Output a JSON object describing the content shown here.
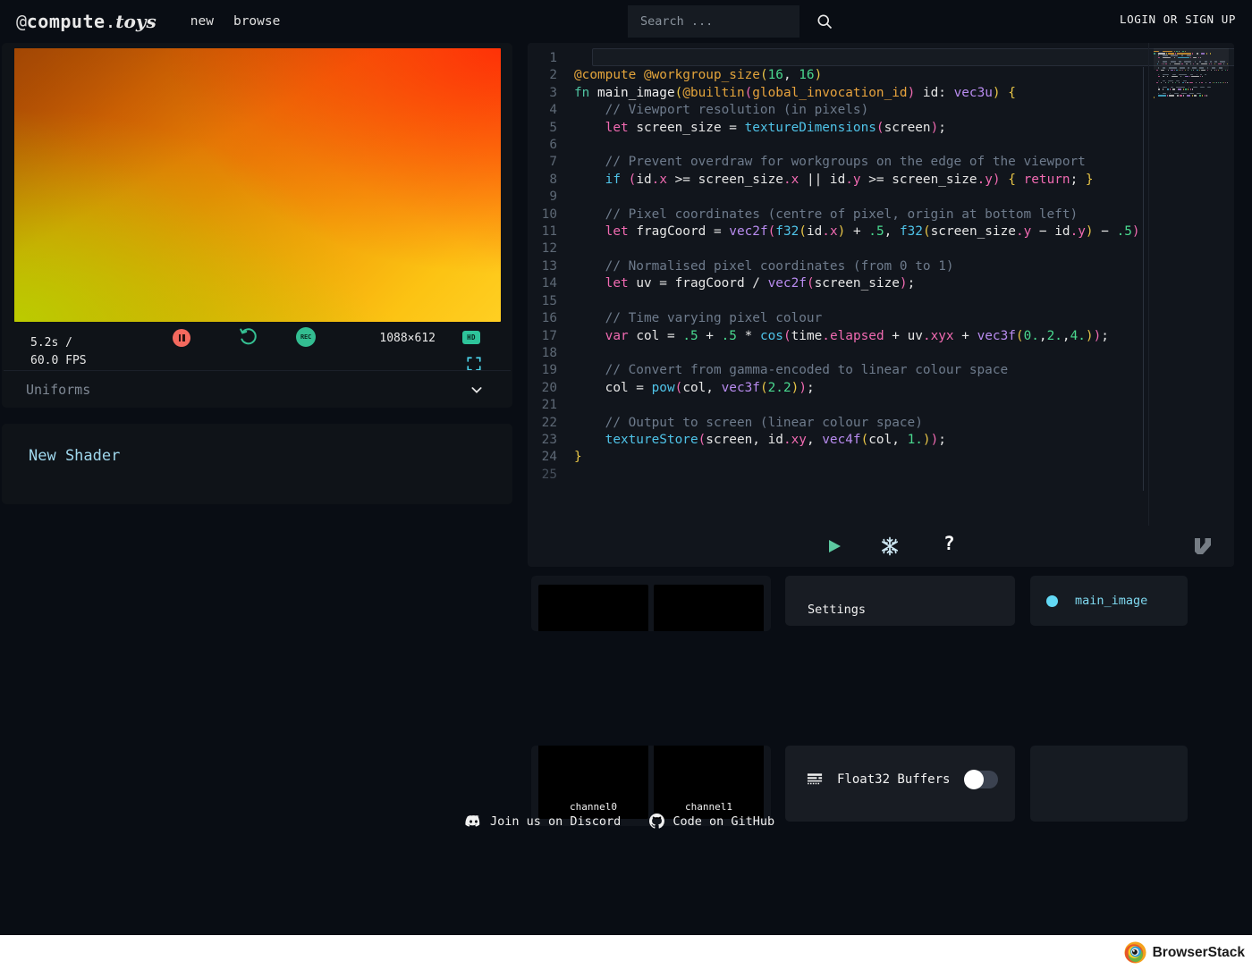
{
  "header": {
    "logo": {
      "at": "@",
      "compute": "compute",
      "dot": ".",
      "toys": "toys"
    },
    "nav": [
      {
        "label": "new",
        "name": "nav-new"
      },
      {
        "label": "browse",
        "name": "nav-browse"
      }
    ],
    "search": {
      "placeholder": "Search ...",
      "value": "",
      "icon": "search-icon"
    },
    "login_label": "LOGIN OR SIGN UP"
  },
  "preview": {
    "time": "5.2s /",
    "fps": "60.0 FPS",
    "resolution": "1088×612",
    "hd_badge": "HD",
    "pause_icon": "pause-icon",
    "reset_icon": "reset-icon",
    "record_icon": "record-icon",
    "record_label": "REC",
    "fullscreen_icon": "fullscreen-icon",
    "uniforms_label": "Uniforms",
    "chevron_icon": "chevron-down-icon"
  },
  "shader": {
    "name": "New Shader"
  },
  "editor": {
    "lines": [
      {
        "n": "1",
        "tokens": []
      },
      {
        "n": "2",
        "tokens": [
          {
            "c": "t-attr",
            "t": "@compute @workgroup_size"
          },
          {
            "c": "t-paren",
            "t": "("
          },
          {
            "c": "t-num",
            "t": "16"
          },
          {
            "c": "t-plain",
            "t": ", "
          },
          {
            "c": "t-num",
            "t": "16"
          },
          {
            "c": "t-paren",
            "t": ")"
          }
        ]
      },
      {
        "n": "3",
        "tokens": [
          {
            "c": "t-kw",
            "t": "fn"
          },
          {
            "c": "t-plain",
            "t": " "
          },
          {
            "c": "t-fn",
            "t": "main_image"
          },
          {
            "c": "t-paren",
            "t": "("
          },
          {
            "c": "t-attr",
            "t": "@builtin"
          },
          {
            "c": "t-paren2",
            "t": "("
          },
          {
            "c": "t-ident",
            "t": "global_invocation_id"
          },
          {
            "c": "t-paren2",
            "t": ")"
          },
          {
            "c": "t-plain",
            "t": " id: "
          },
          {
            "c": "t-type",
            "t": "vec3u"
          },
          {
            "c": "t-paren",
            "t": ")"
          },
          {
            "c": "t-plain",
            "t": " "
          },
          {
            "c": "t-brace",
            "t": "{"
          }
        ]
      },
      {
        "n": "4",
        "tokens": [
          {
            "c": "t-cmt",
            "t": "    // Viewport resolution (in pixels)"
          }
        ]
      },
      {
        "n": "5",
        "tokens": [
          {
            "c": "t-plain",
            "t": "    "
          },
          {
            "c": "t-kw2",
            "t": "let"
          },
          {
            "c": "t-plain",
            "t": " screen_size = "
          },
          {
            "c": "t-call",
            "t": "textureDimensions"
          },
          {
            "c": "t-paren2",
            "t": "("
          },
          {
            "c": "t-plain",
            "t": "screen"
          },
          {
            "c": "t-paren2",
            "t": ")"
          },
          {
            "c": "t-plain",
            "t": ";"
          }
        ]
      },
      {
        "n": "6",
        "tokens": []
      },
      {
        "n": "7",
        "tokens": [
          {
            "c": "t-cmt",
            "t": "    // Prevent overdraw for workgroups on the edge of the viewport"
          }
        ]
      },
      {
        "n": "8",
        "tokens": [
          {
            "c": "t-plain",
            "t": "    "
          },
          {
            "c": "t-call",
            "t": "if"
          },
          {
            "c": "t-plain",
            "t": " "
          },
          {
            "c": "t-paren2",
            "t": "("
          },
          {
            "c": "t-plain",
            "t": "id"
          },
          {
            "c": "t-prop",
            "t": ".x"
          },
          {
            "c": "t-plain",
            "t": " >= screen_size"
          },
          {
            "c": "t-prop",
            "t": ".x"
          },
          {
            "c": "t-plain",
            "t": " || id"
          },
          {
            "c": "t-prop",
            "t": ".y"
          },
          {
            "c": "t-plain",
            "t": " >= screen_size"
          },
          {
            "c": "t-prop",
            "t": ".y"
          },
          {
            "c": "t-paren2",
            "t": ")"
          },
          {
            "c": "t-plain",
            "t": " "
          },
          {
            "c": "t-brace",
            "t": "{"
          },
          {
            "c": "t-plain",
            "t": " "
          },
          {
            "c": "t-kw2",
            "t": "return"
          },
          {
            "c": "t-plain",
            "t": "; "
          },
          {
            "c": "t-brace",
            "t": "}"
          }
        ]
      },
      {
        "n": "9",
        "tokens": []
      },
      {
        "n": "10",
        "tokens": [
          {
            "c": "t-cmt",
            "t": "    // Pixel coordinates (centre of pixel, origin at bottom left)"
          }
        ]
      },
      {
        "n": "11",
        "tokens": [
          {
            "c": "t-plain",
            "t": "    "
          },
          {
            "c": "t-kw2",
            "t": "let"
          },
          {
            "c": "t-plain",
            "t": " fragCoord = "
          },
          {
            "c": "t-type",
            "t": "vec2f"
          },
          {
            "c": "t-paren2",
            "t": "("
          },
          {
            "c": "t-call",
            "t": "f32"
          },
          {
            "c": "t-paren",
            "t": "("
          },
          {
            "c": "t-plain",
            "t": "id"
          },
          {
            "c": "t-prop",
            "t": ".x"
          },
          {
            "c": "t-paren",
            "t": ")"
          },
          {
            "c": "t-plain",
            "t": " + "
          },
          {
            "c": "t-num",
            "t": ".5"
          },
          {
            "c": "t-plain",
            "t": ", "
          },
          {
            "c": "t-call",
            "t": "f32"
          },
          {
            "c": "t-paren",
            "t": "("
          },
          {
            "c": "t-plain",
            "t": "screen_size"
          },
          {
            "c": "t-prop",
            "t": ".y"
          },
          {
            "c": "t-plain",
            "t": " − id"
          },
          {
            "c": "t-prop",
            "t": ".y"
          },
          {
            "c": "t-paren",
            "t": ")"
          },
          {
            "c": "t-plain",
            "t": " − "
          },
          {
            "c": "t-num",
            "t": ".5"
          },
          {
            "c": "t-paren2",
            "t": ")"
          }
        ]
      },
      {
        "n": "12",
        "tokens": []
      },
      {
        "n": "13",
        "tokens": [
          {
            "c": "t-cmt",
            "t": "    // Normalised pixel coordinates (from 0 to 1)"
          }
        ]
      },
      {
        "n": "14",
        "tokens": [
          {
            "c": "t-plain",
            "t": "    "
          },
          {
            "c": "t-kw2",
            "t": "let"
          },
          {
            "c": "t-plain",
            "t": " uv = fragCoord / "
          },
          {
            "c": "t-type",
            "t": "vec2f"
          },
          {
            "c": "t-paren2",
            "t": "("
          },
          {
            "c": "t-plain",
            "t": "screen_size"
          },
          {
            "c": "t-paren2",
            "t": ")"
          },
          {
            "c": "t-plain",
            "t": ";"
          }
        ]
      },
      {
        "n": "15",
        "tokens": []
      },
      {
        "n": "16",
        "tokens": [
          {
            "c": "t-cmt",
            "t": "    // Time varying pixel colour"
          }
        ]
      },
      {
        "n": "17",
        "tokens": [
          {
            "c": "t-plain",
            "t": "    "
          },
          {
            "c": "t-kw2",
            "t": "var"
          },
          {
            "c": "t-plain",
            "t": " col = "
          },
          {
            "c": "t-num",
            "t": ".5"
          },
          {
            "c": "t-plain",
            "t": " + "
          },
          {
            "c": "t-num",
            "t": ".5"
          },
          {
            "c": "t-plain",
            "t": " * "
          },
          {
            "c": "t-call",
            "t": "cos"
          },
          {
            "c": "t-paren2",
            "t": "("
          },
          {
            "c": "t-plain",
            "t": "time"
          },
          {
            "c": "t-prop",
            "t": ".elapsed"
          },
          {
            "c": "t-plain",
            "t": " + uv"
          },
          {
            "c": "t-prop",
            "t": ".xyx"
          },
          {
            "c": "t-plain",
            "t": " + "
          },
          {
            "c": "t-type",
            "t": "vec3f"
          },
          {
            "c": "t-paren",
            "t": "("
          },
          {
            "c": "t-num",
            "t": "0."
          },
          {
            "c": "t-plain",
            "t": ","
          },
          {
            "c": "t-num",
            "t": "2."
          },
          {
            "c": "t-plain",
            "t": ","
          },
          {
            "c": "t-num",
            "t": "4."
          },
          {
            "c": "t-paren",
            "t": ")"
          },
          {
            "c": "t-paren2",
            "t": ")"
          },
          {
            "c": "t-plain",
            "t": ";"
          }
        ]
      },
      {
        "n": "18",
        "tokens": []
      },
      {
        "n": "19",
        "tokens": [
          {
            "c": "t-cmt",
            "t": "    // Convert from gamma-encoded to linear colour space"
          }
        ]
      },
      {
        "n": "20",
        "tokens": [
          {
            "c": "t-plain",
            "t": "    col = "
          },
          {
            "c": "t-call",
            "t": "pow"
          },
          {
            "c": "t-paren2",
            "t": "("
          },
          {
            "c": "t-plain",
            "t": "col, "
          },
          {
            "c": "t-type",
            "t": "vec3f"
          },
          {
            "c": "t-paren",
            "t": "("
          },
          {
            "c": "t-num",
            "t": "2.2"
          },
          {
            "c": "t-paren",
            "t": ")"
          },
          {
            "c": "t-paren2",
            "t": ")"
          },
          {
            "c": "t-plain",
            "t": ";"
          }
        ]
      },
      {
        "n": "21",
        "tokens": []
      },
      {
        "n": "22",
        "tokens": [
          {
            "c": "t-cmt",
            "t": "    // Output to screen (linear colour space)"
          }
        ]
      },
      {
        "n": "23",
        "tokens": [
          {
            "c": "t-plain",
            "t": "    "
          },
          {
            "c": "t-call",
            "t": "textureStore"
          },
          {
            "c": "t-paren2",
            "t": "("
          },
          {
            "c": "t-plain",
            "t": "screen, id"
          },
          {
            "c": "t-prop",
            "t": ".xy"
          },
          {
            "c": "t-plain",
            "t": ", "
          },
          {
            "c": "t-type",
            "t": "vec4f"
          },
          {
            "c": "t-paren",
            "t": "("
          },
          {
            "c": "t-plain",
            "t": "col, "
          },
          {
            "c": "t-num",
            "t": "1."
          },
          {
            "c": "t-paren",
            "t": ")"
          },
          {
            "c": "t-paren2",
            "t": ")"
          },
          {
            "c": "t-plain",
            "t": ";"
          }
        ]
      },
      {
        "n": "24",
        "tokens": [
          {
            "c": "t-brace",
            "t": "}"
          }
        ]
      },
      {
        "n": "25",
        "tokens": []
      }
    ],
    "toolbar": {
      "play_icon": "play-icon",
      "freeze_icon": "snowflake-icon",
      "help_icon": "question-mark-icon",
      "help_label": "?",
      "vim_icon": "vim-logo-icon"
    }
  },
  "panels": {
    "textures_top": {
      "name": "texture-slots-top",
      "thumbs": [
        "",
        ""
      ]
    },
    "settings": {
      "label": "Settings"
    },
    "entry_point": {
      "label": "main_image",
      "dot_color": "#63d9f5"
    },
    "channels": {
      "labels": [
        "channel0",
        "channel1"
      ]
    },
    "float32": {
      "label": "Float32 Buffers",
      "enabled": false,
      "icon": "buffers-icon"
    }
  },
  "footer": {
    "links": [
      {
        "label": "Join us on Discord",
        "icon": "discord-icon",
        "name": "discord-link"
      },
      {
        "label": "Code on GitHub",
        "icon": "github-icon",
        "name": "github-link"
      }
    ]
  },
  "watermark": {
    "label": "BrowserStack"
  },
  "colors": {
    "bg": "#090d14",
    "panel": "#0f1318",
    "editor_bg": "#11151c",
    "accent_teal": "#2ec49a",
    "accent_cyan": "#63d9f5",
    "accent_red": "#f4695e"
  }
}
